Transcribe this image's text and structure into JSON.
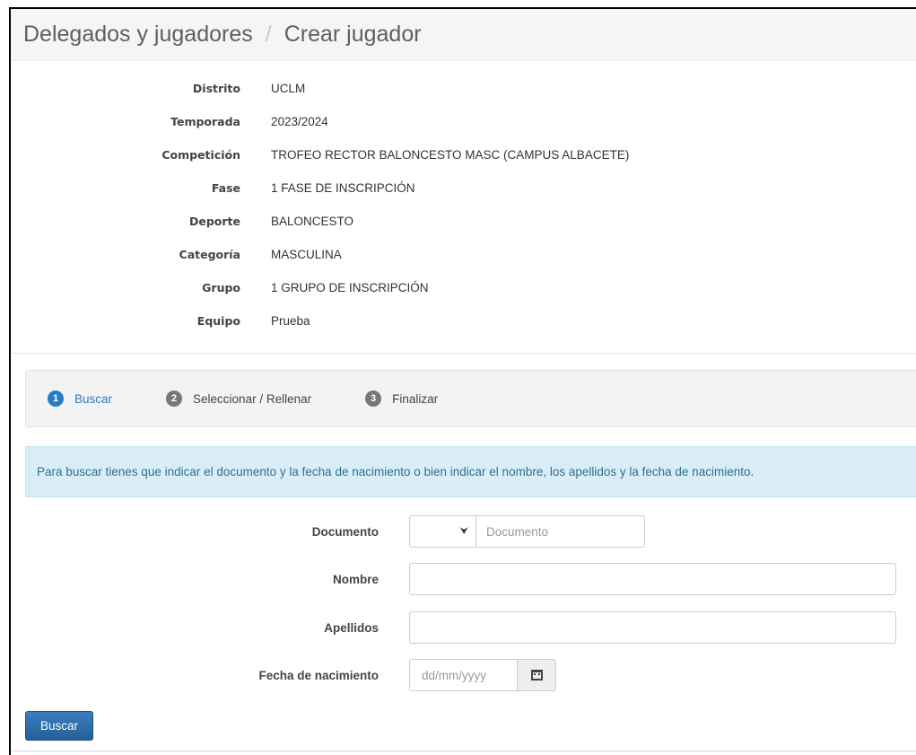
{
  "breadcrumb": {
    "section": "Delegados y jugadores",
    "separator": "/",
    "current": "Crear jugador"
  },
  "info": [
    {
      "label": "Distrito",
      "value": "UCLM"
    },
    {
      "label": "Temporada",
      "value": "2023/2024"
    },
    {
      "label": "Competición",
      "value": "TROFEO RECTOR BALONCESTO MASC (CAMPUS ALBACETE)"
    },
    {
      "label": "Fase",
      "value": "1 FASE DE INSCRIPCIÓN"
    },
    {
      "label": "Deporte",
      "value": "BALONCESTO"
    },
    {
      "label": "Categoría",
      "value": "MASCULINA"
    },
    {
      "label": "Grupo",
      "value": "1 GRUPO DE INSCRIPCIÓN"
    },
    {
      "label": "Equipo",
      "value": "Prueba"
    }
  ],
  "wizard": {
    "steps": [
      {
        "num": "1",
        "label": "Buscar",
        "active": true
      },
      {
        "num": "2",
        "label": "Seleccionar / Rellenar",
        "active": false
      },
      {
        "num": "3",
        "label": "Finalizar",
        "active": false
      }
    ]
  },
  "alert": {
    "text": "Para buscar tienes que indicar el documento y la fecha de nacimiento o bien indicar el nombre, los apellidos y la fecha de nacimiento."
  },
  "form": {
    "documento_label": "Documento",
    "documento_placeholder": "Documento",
    "nombre_label": "Nombre",
    "apellidos_label": "Apellidos",
    "fecha_label": "Fecha de nacimiento",
    "fecha_placeholder": "dd/mm/yyyy",
    "submit_label": "Buscar"
  },
  "icons": {
    "select_arrow": "chevron-down-icon",
    "date_button": "calendar-icon"
  },
  "colors": {
    "primary": "#2a7bc6",
    "alert_bg": "#d9edf7",
    "alert_text": "#31708f"
  }
}
